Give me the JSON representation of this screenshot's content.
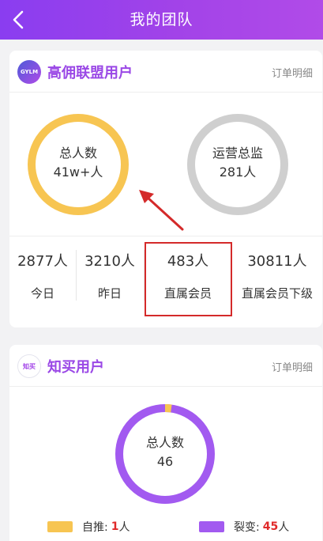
{
  "header": {
    "title": "我的团队",
    "back_icon": "chevron-left-icon"
  },
  "card1": {
    "logo_text": "GYLM",
    "title": "高佣联盟用户",
    "detail_link": "订单明细",
    "ring_total_label": "总人数",
    "ring_total_value": "41w+人",
    "ring_director_label": "运营总监",
    "ring_director_value": "281人",
    "stats": [
      {
        "value": "2877人",
        "label": "今日"
      },
      {
        "value": "3210人",
        "label": "昨日"
      },
      {
        "value": "483人",
        "label": "直属会员"
      },
      {
        "value": "30811人",
        "label": "直属会员下级"
      }
    ]
  },
  "card2": {
    "logo_text": "知买",
    "title": "知买用户",
    "detail_link": "订单明细",
    "ring_label": "总人数",
    "ring_value": "46",
    "legend": [
      {
        "label": "自推:",
        "num": "1",
        "unit": "人",
        "color": "#f7c552"
      },
      {
        "label": "裂变:",
        "num": "45",
        "unit": "人",
        "color": "#a25af0"
      }
    ]
  },
  "colors": {
    "accent_purple": "#9a48e6",
    "ring_yellow": "#f7c552",
    "ring_gray": "#cfcfcf",
    "ring_purple": "#a25af0",
    "annotation_red": "#d42a2a"
  }
}
